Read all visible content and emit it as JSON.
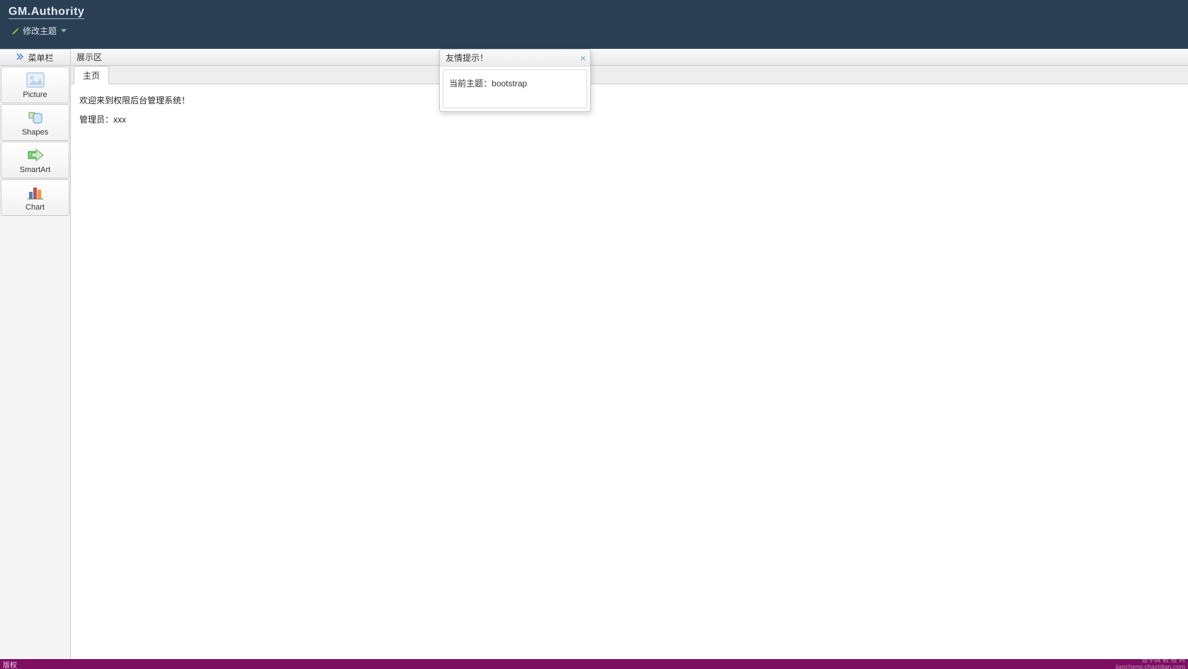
{
  "header": {
    "brand": "GM.Authority",
    "theme_button_label": "修改主题"
  },
  "sidebar": {
    "header_label": "菜单栏",
    "items": [
      {
        "label": "Picture",
        "icon": "picture-icon"
      },
      {
        "label": "Shapes",
        "icon": "shapes-icon"
      },
      {
        "label": "SmartArt",
        "icon": "smartart-icon"
      },
      {
        "label": "Chart",
        "icon": "chart-icon"
      }
    ]
  },
  "main": {
    "panel_title": "展示区",
    "tab_label": "主页",
    "welcome_text": "欢迎来到权限后台管理系统！",
    "admin_text": "管理员：xxx"
  },
  "popup": {
    "title": "友情提示！",
    "body_label": "当前主题：",
    "body_value": "bootstrap"
  },
  "footer": {
    "left": "版权",
    "watermark_line1": "查字典 教 程 网",
    "watermark_line2": "jiaocheng.chazidian.com"
  }
}
